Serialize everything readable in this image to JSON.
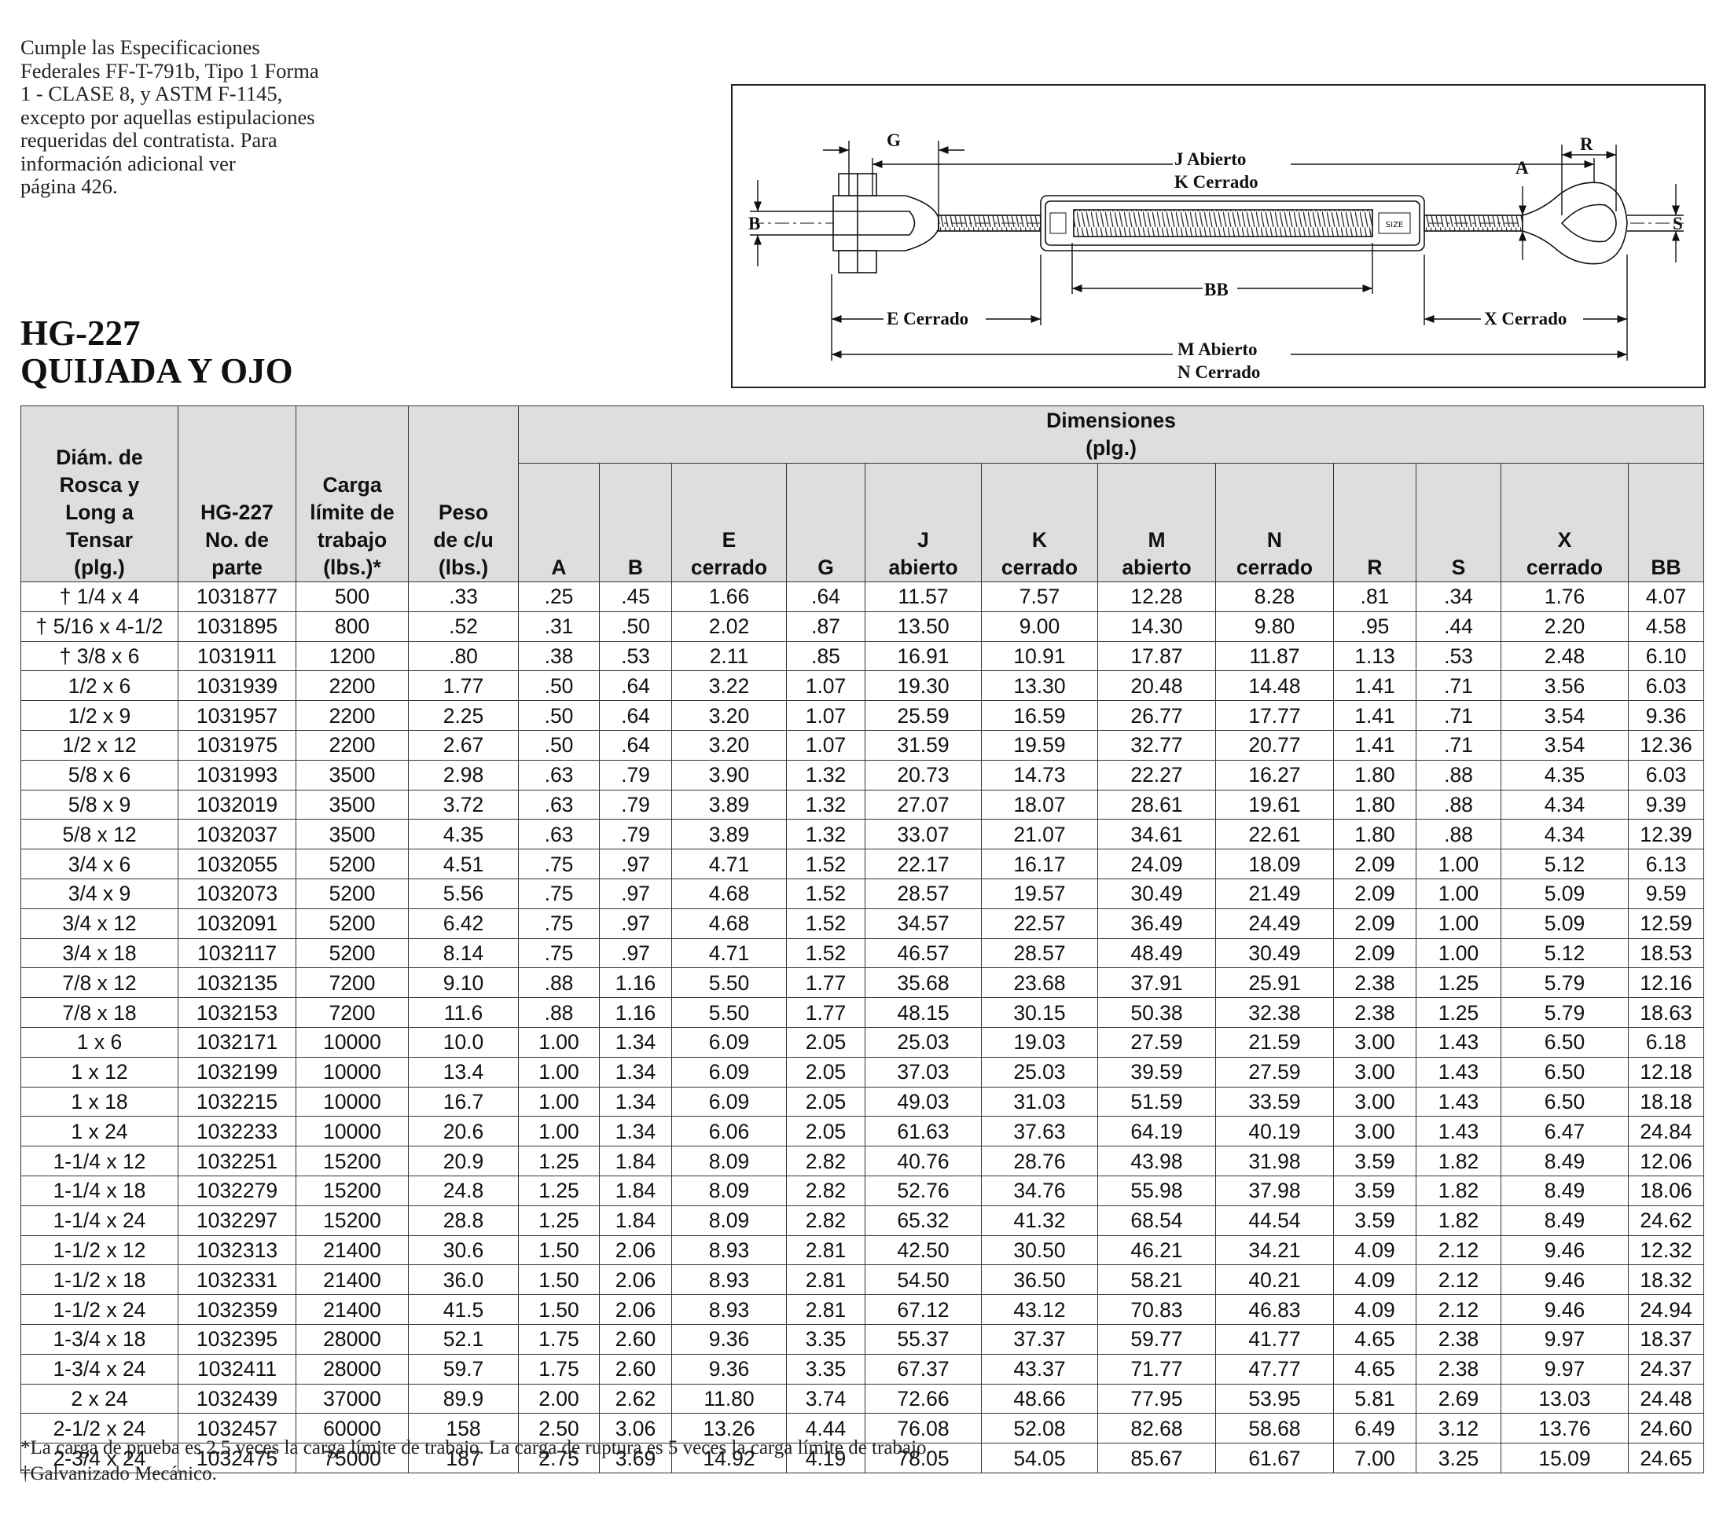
{
  "intro": {
    "lines": [
      "Cumple las Especificaciones",
      "Federales FF-T-791b, Tipo 1 Forma",
      "1 - CLASE 8, y ASTM F-1145,",
      "excepto por aquellas estipulaciones",
      "requeridas del contratista.  Para",
      "información adicional ver",
      "página 426."
    ]
  },
  "title": {
    "code": "HG-227",
    "name": "QUIJADA Y OJO"
  },
  "diagram": {
    "labels": {
      "j": "J  Abierto",
      "k": "K Cerrado",
      "g": "G",
      "r": "R",
      "a": "A",
      "b": "B",
      "s": "S",
      "bb": "BB",
      "e": "E  Cerrado",
      "x": "X  Cerrado",
      "m": "M  Abierto",
      "n": "N   Cerrado",
      "size": "SIZE"
    }
  },
  "table": {
    "head": {
      "col1": [
        "Diám. de",
        "Rosca y",
        "Long a",
        "Tensar",
        "(plg.)"
      ],
      "col2": [
        "HG-227",
        "No. de",
        "parte"
      ],
      "col3": [
        "Carga",
        "límite de",
        "trabajo",
        "(lbs.)*"
      ],
      "col4": [
        "Peso",
        "de c/u",
        "(lbs.)"
      ],
      "dims_title": "Dimensiones",
      "dims_unit": "(plg.)",
      "dims": [
        [
          "A"
        ],
        [
          "B"
        ],
        [
          "E",
          "cerrado"
        ],
        [
          "G"
        ],
        [
          "J",
          "abierto"
        ],
        [
          "K",
          "cerrado"
        ],
        [
          "M",
          "abierto"
        ],
        [
          "N",
          "cerrado"
        ],
        [
          "R"
        ],
        [
          "S"
        ],
        [
          "X",
          "cerrado"
        ],
        [
          "BB"
        ]
      ]
    },
    "rows": [
      [
        "† 1/4 x 4",
        "1031877",
        "500",
        ".33",
        ".25",
        ".45",
        "1.66",
        ".64",
        "11.57",
        "7.57",
        "12.28",
        "8.28",
        ".81",
        ".34",
        "1.76",
        "4.07"
      ],
      [
        "† 5/16 x 4-1/2",
        "1031895",
        "800",
        ".52",
        ".31",
        ".50",
        "2.02",
        ".87",
        "13.50",
        "9.00",
        "14.30",
        "9.80",
        ".95",
        ".44",
        "2.20",
        "4.58"
      ],
      [
        "† 3/8 x 6",
        "1031911",
        "1200",
        ".80",
        ".38",
        ".53",
        "2.11",
        ".85",
        "16.91",
        "10.91",
        "17.87",
        "11.87",
        "1.13",
        ".53",
        "2.48",
        "6.10"
      ],
      [
        "1/2 x 6",
        "1031939",
        "2200",
        "1.77",
        ".50",
        ".64",
        "3.22",
        "1.07",
        "19.30",
        "13.30",
        "20.48",
        "14.48",
        "1.41",
        ".71",
        "3.56",
        "6.03"
      ],
      [
        "1/2 x 9",
        "1031957",
        "2200",
        "2.25",
        ".50",
        ".64",
        "3.20",
        "1.07",
        "25.59",
        "16.59",
        "26.77",
        "17.77",
        "1.41",
        ".71",
        "3.54",
        "9.36"
      ],
      [
        "1/2 x 12",
        "1031975",
        "2200",
        "2.67",
        ".50",
        ".64",
        "3.20",
        "1.07",
        "31.59",
        "19.59",
        "32.77",
        "20.77",
        "1.41",
        ".71",
        "3.54",
        "12.36"
      ],
      [
        "5/8 x 6",
        "1031993",
        "3500",
        "2.98",
        ".63",
        ".79",
        "3.90",
        "1.32",
        "20.73",
        "14.73",
        "22.27",
        "16.27",
        "1.80",
        ".88",
        "4.35",
        "6.03"
      ],
      [
        "5/8 x 9",
        "1032019",
        "3500",
        "3.72",
        ".63",
        ".79",
        "3.89",
        "1.32",
        "27.07",
        "18.07",
        "28.61",
        "19.61",
        "1.80",
        ".88",
        "4.34",
        "9.39"
      ],
      [
        "5/8 x 12",
        "1032037",
        "3500",
        "4.35",
        ".63",
        ".79",
        "3.89",
        "1.32",
        "33.07",
        "21.07",
        "34.61",
        "22.61",
        "1.80",
        ".88",
        "4.34",
        "12.39"
      ],
      [
        "3/4 x 6",
        "1032055",
        "5200",
        "4.51",
        ".75",
        ".97",
        "4.71",
        "1.52",
        "22.17",
        "16.17",
        "24.09",
        "18.09",
        "2.09",
        "1.00",
        "5.12",
        "6.13"
      ],
      [
        "3/4 x 9",
        "1032073",
        "5200",
        "5.56",
        ".75",
        ".97",
        "4.68",
        "1.52",
        "28.57",
        "19.57",
        "30.49",
        "21.49",
        "2.09",
        "1.00",
        "5.09",
        "9.59"
      ],
      [
        "3/4 x 12",
        "1032091",
        "5200",
        "6.42",
        ".75",
        ".97",
        "4.68",
        "1.52",
        "34.57",
        "22.57",
        "36.49",
        "24.49",
        "2.09",
        "1.00",
        "5.09",
        "12.59"
      ],
      [
        "3/4 x 18",
        "1032117",
        "5200",
        "8.14",
        ".75",
        ".97",
        "4.71",
        "1.52",
        "46.57",
        "28.57",
        "48.49",
        "30.49",
        "2.09",
        "1.00",
        "5.12",
        "18.53"
      ],
      [
        "7/8 x 12",
        "1032135",
        "7200",
        "9.10",
        ".88",
        "1.16",
        "5.50",
        "1.77",
        "35.68",
        "23.68",
        "37.91",
        "25.91",
        "2.38",
        "1.25",
        "5.79",
        "12.16"
      ],
      [
        "7/8 x 18",
        "1032153",
        "7200",
        "11.6",
        ".88",
        "1.16",
        "5.50",
        "1.77",
        "48.15",
        "30.15",
        "50.38",
        "32.38",
        "2.38",
        "1.25",
        "5.79",
        "18.63"
      ],
      [
        "1 x 6",
        "1032171",
        "10000",
        "10.0",
        "1.00",
        "1.34",
        "6.09",
        "2.05",
        "25.03",
        "19.03",
        "27.59",
        "21.59",
        "3.00",
        "1.43",
        "6.50",
        "6.18"
      ],
      [
        "1 x 12",
        "1032199",
        "10000",
        "13.4",
        "1.00",
        "1.34",
        "6.09",
        "2.05",
        "37.03",
        "25.03",
        "39.59",
        "27.59",
        "3.00",
        "1.43",
        "6.50",
        "12.18"
      ],
      [
        "1 x 18",
        "1032215",
        "10000",
        "16.7",
        "1.00",
        "1.34",
        "6.09",
        "2.05",
        "49.03",
        "31.03",
        "51.59",
        "33.59",
        "3.00",
        "1.43",
        "6.50",
        "18.18"
      ],
      [
        "1 x 24",
        "1032233",
        "10000",
        "20.6",
        "1.00",
        "1.34",
        "6.06",
        "2.05",
        "61.63",
        "37.63",
        "64.19",
        "40.19",
        "3.00",
        "1.43",
        "6.47",
        "24.84"
      ],
      [
        "1-1/4 x 12",
        "1032251",
        "15200",
        "20.9",
        "1.25",
        "1.84",
        "8.09",
        "2.82",
        "40.76",
        "28.76",
        "43.98",
        "31.98",
        "3.59",
        "1.82",
        "8.49",
        "12.06"
      ],
      [
        "1-1/4 x 18",
        "1032279",
        "15200",
        "24.8",
        "1.25",
        "1.84",
        "8.09",
        "2.82",
        "52.76",
        "34.76",
        "55.98",
        "37.98",
        "3.59",
        "1.82",
        "8.49",
        "18.06"
      ],
      [
        "1-1/4 x 24",
        "1032297",
        "15200",
        "28.8",
        "1.25",
        "1.84",
        "8.09",
        "2.82",
        "65.32",
        "41.32",
        "68.54",
        "44.54",
        "3.59",
        "1.82",
        "8.49",
        "24.62"
      ],
      [
        "1-1/2 x 12",
        "1032313",
        "21400",
        "30.6",
        "1.50",
        "2.06",
        "8.93",
        "2.81",
        "42.50",
        "30.50",
        "46.21",
        "34.21",
        "4.09",
        "2.12",
        "9.46",
        "12.32"
      ],
      [
        "1-1/2 x 18",
        "1032331",
        "21400",
        "36.0",
        "1.50",
        "2.06",
        "8.93",
        "2.81",
        "54.50",
        "36.50",
        "58.21",
        "40.21",
        "4.09",
        "2.12",
        "9.46",
        "18.32"
      ],
      [
        "1-1/2 x 24",
        "1032359",
        "21400",
        "41.5",
        "1.50",
        "2.06",
        "8.93",
        "2.81",
        "67.12",
        "43.12",
        "70.83",
        "46.83",
        "4.09",
        "2.12",
        "9.46",
        "24.94"
      ],
      [
        "1-3/4 x 18",
        "1032395",
        "28000",
        "52.1",
        "1.75",
        "2.60",
        "9.36",
        "3.35",
        "55.37",
        "37.37",
        "59.77",
        "41.77",
        "4.65",
        "2.38",
        "9.97",
        "18.37"
      ],
      [
        "1-3/4 x 24",
        "1032411",
        "28000",
        "59.7",
        "1.75",
        "2.60",
        "9.36",
        "3.35",
        "67.37",
        "43.37",
        "71.77",
        "47.77",
        "4.65",
        "2.38",
        "9.97",
        "24.37"
      ],
      [
        "2 x 24",
        "1032439",
        "37000",
        "89.9",
        "2.00",
        "2.62",
        "11.80",
        "3.74",
        "72.66",
        "48.66",
        "77.95",
        "53.95",
        "5.81",
        "2.69",
        "13.03",
        "24.48"
      ],
      [
        "2-1/2 x 24",
        "1032457",
        "60000",
        "158",
        "2.50",
        "3.06",
        "13.26",
        "4.44",
        "76.08",
        "52.08",
        "82.68",
        "58.68",
        "6.49",
        "3.12",
        "13.76",
        "24.60"
      ],
      [
        "2-3/4 x 24",
        "1032475",
        "75000",
        "187",
        "2.75",
        "3.69",
        "14.92",
        "4.19",
        "78.05",
        "54.05",
        "85.67",
        "61.67",
        "7.00",
        "3.25",
        "15.09",
        "24.65"
      ]
    ]
  },
  "notes": {
    "load": "*La carga de prueba es 2.5 veces la carga límite de trabajo. La carga de ruptura es 5 veces la carga límite de trabajo.",
    "galv": "†Galvanizado Mecánico."
  }
}
